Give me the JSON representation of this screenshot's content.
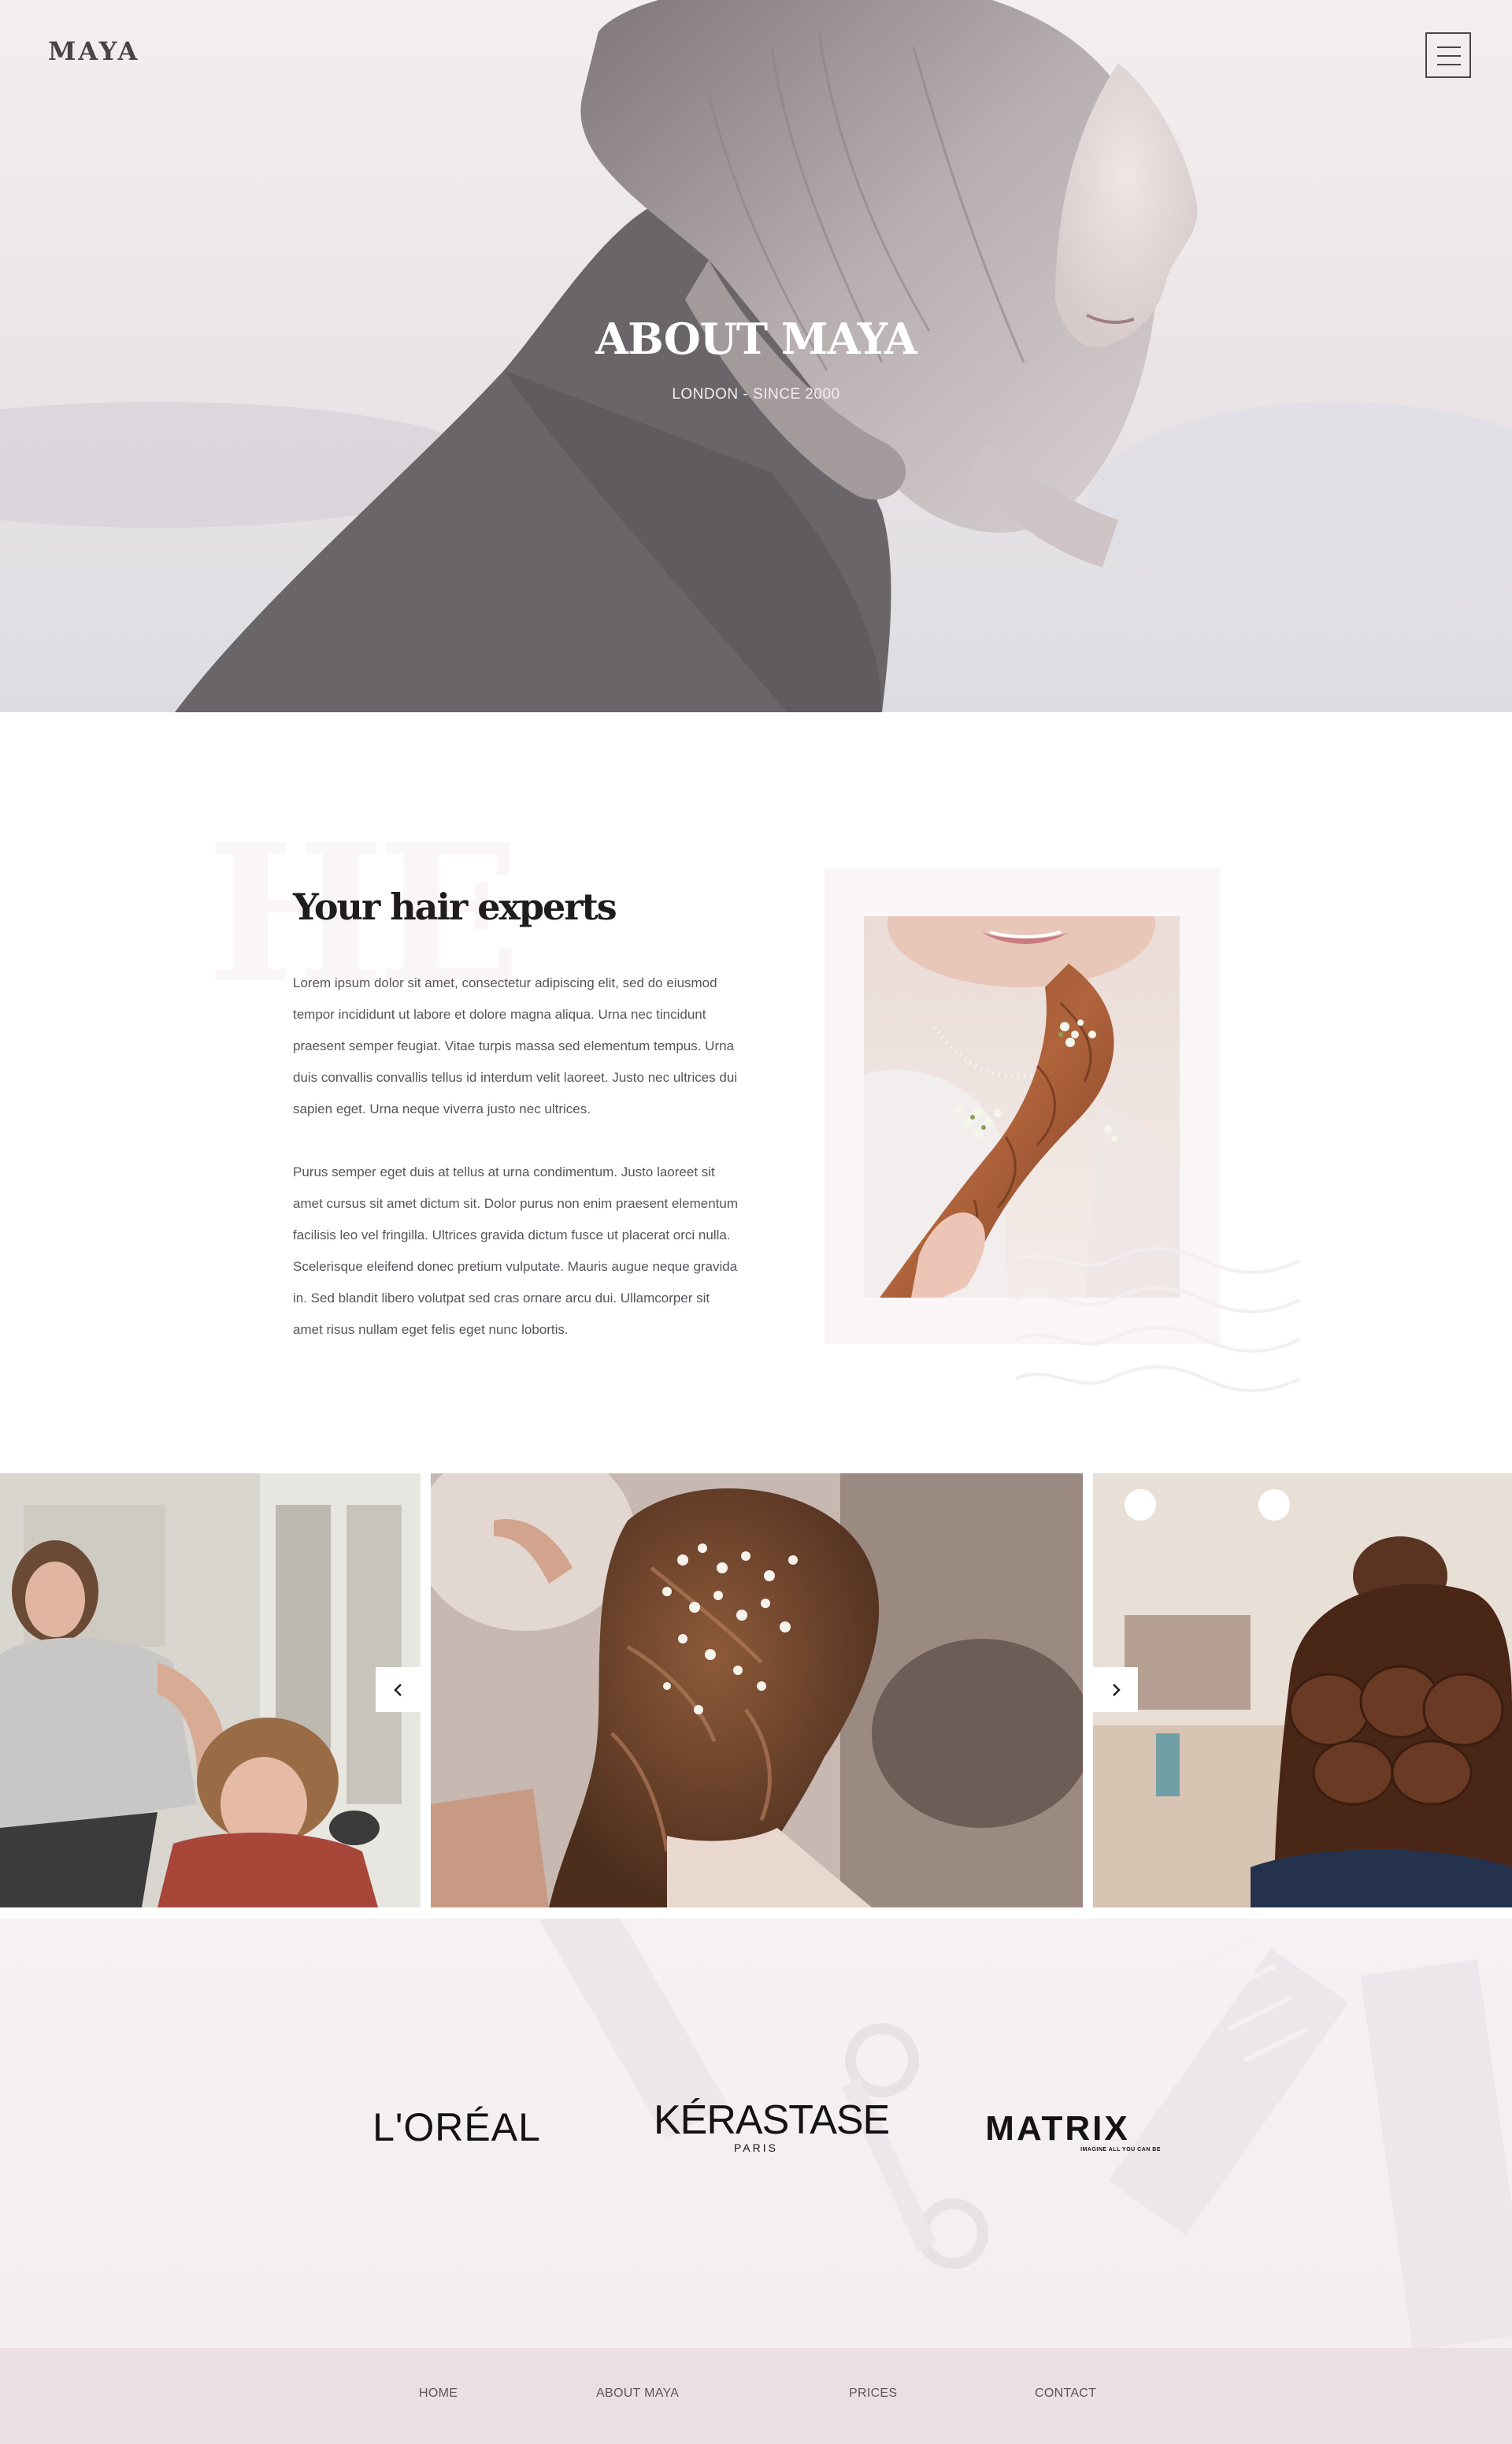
{
  "header": {
    "logo": "MAYA",
    "menu_icon": "hamburger-menu-icon"
  },
  "hero": {
    "title": "ABOUT MAYA",
    "subtitle": "LONDON  -  SINCE 2000"
  },
  "about": {
    "title": "Your hair experts",
    "paragraph_1": "Lorem ipsum dolor sit amet, consectetur adipiscing elit, sed do eiusmod tempor incididunt ut labore et dolore magna aliqua. Urna nec tincidunt praesent semper feugiat. Vitae turpis massa sed elementum tempus. Urna duis convallis convallis tellus id interdum velit laoreet. Justo nec ultrices dui sapien eget. Urna neque viverra justo nec ultrices.",
    "paragraph_2": "Purus semper eget duis at tellus at urna condimentum. Justo laoreet sit amet cursus sit amet dictum sit. Dolor purus non enim praesent elementum facilisis leo vel fringilla. Ultrices gravida dictum fusce ut placerat orci nulla. Scelerisque eleifend donec pretium vulputate. Mauris augue neque gravida in. Sed blandit libero volutpat sed cras ornare arcu dui. Ullamcorper sit amet risus nullam eget felis eget nunc lobortis."
  },
  "gallery": {
    "prev_icon": "chevron-left-icon",
    "next_icon": "chevron-right-icon"
  },
  "brands": {
    "loreal": "L'ORÉAL",
    "kerastase": "KÉRASTASE",
    "kerastase_sub": "PARIS",
    "matrix": "MATRIX",
    "matrix_tag": "IMAGINE ALL YOU CAN BE"
  },
  "footer": {
    "nav": [
      "HOME",
      "ABOUT MAYA",
      "PRICES",
      "CONTACT"
    ]
  },
  "colors": {
    "hero_bg": "#f4eff0",
    "brands_bg": "#f6f1f3",
    "footer_bg": "#ebdfe3",
    "heading": "#1f1c1e",
    "body_text": "#58545a"
  }
}
